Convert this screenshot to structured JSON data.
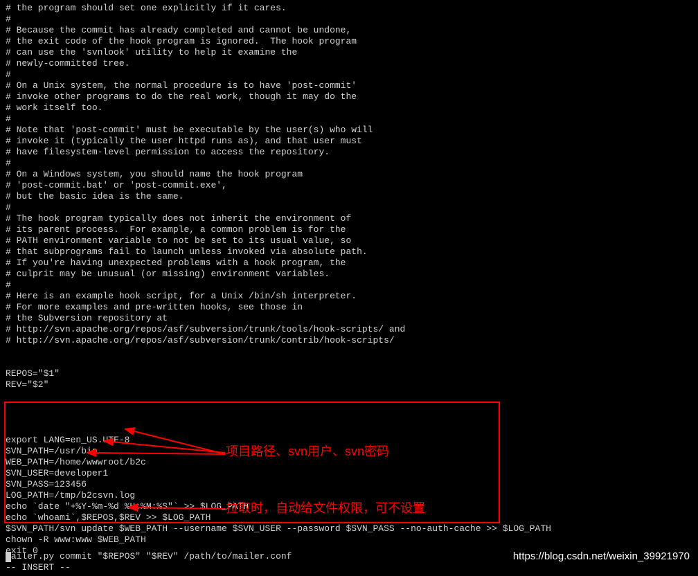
{
  "lines": [
    "# the program should set one explicitly if it cares.",
    "#",
    "# Because the commit has already completed and cannot be undone,",
    "# the exit code of the hook program is ignored.  The hook program",
    "# can use the 'svnlook' utility to help it examine the",
    "# newly-committed tree.",
    "#",
    "# On a Unix system, the normal procedure is to have 'post-commit'",
    "# invoke other programs to do the real work, though it may do the",
    "# work itself too.",
    "#",
    "# Note that 'post-commit' must be executable by the user(s) who will",
    "# invoke it (typically the user httpd runs as), and that user must",
    "# have filesystem-level permission to access the repository.",
    "#",
    "# On a Windows system, you should name the hook program",
    "# 'post-commit.bat' or 'post-commit.exe',",
    "# but the basic idea is the same.",
    "#",
    "# The hook program typically does not inherit the environment of",
    "# its parent process.  For example, a common problem is for the",
    "# PATH environment variable to not be set to its usual value, so",
    "# that subprograms fail to launch unless invoked via absolute path.",
    "# If you're having unexpected problems with a hook program, the",
    "# culprit may be unusual (or missing) environment variables.",
    "#",
    "# Here is an example hook script, for a Unix /bin/sh interpreter.",
    "# For more examples and pre-written hooks, see those in",
    "# the Subversion repository at",
    "# http://svn.apache.org/repos/asf/subversion/trunk/tools/hook-scripts/ and",
    "# http://svn.apache.org/repos/asf/subversion/trunk/contrib/hook-scripts/",
    "",
    "",
    "REPOS=\"$1\"",
    "REV=\"$2\"",
    "",
    "",
    "",
    "",
    "export LANG=en_US.UTF-8",
    "SVN_PATH=/usr/bin",
    "WEB_PATH=/home/wwwroot/b2c",
    "SVN_USER=developer1",
    "SVN_PASS=123456",
    "LOG_PATH=/tmp/b2csvn.log",
    "echo `date \"+%Y-%m-%d %H:%M:%S\"` >> $LOG_PATH",
    "echo `whoami`,$REPOS,$REV >> $LOG_PATH",
    "$SVN_PATH/svn update $WEB_PATH --username $SVN_USER --password $SVN_PASS --no-auth-cache >> $LOG_PATH",
    "chown -R www:www $WEB_PATH",
    "exit 0"
  ],
  "mailer_line": "ailer.py commit \"$REPOS\" \"$REV\" /path/to/mailer.conf",
  "insert_mode": "-- INSERT --",
  "annotation1": "项目路径、svn用户、svn密码",
  "annotation2": "拉取时，自动给文件权限，可不设置",
  "watermark": "https://blog.csdn.net/weixin_39921970"
}
